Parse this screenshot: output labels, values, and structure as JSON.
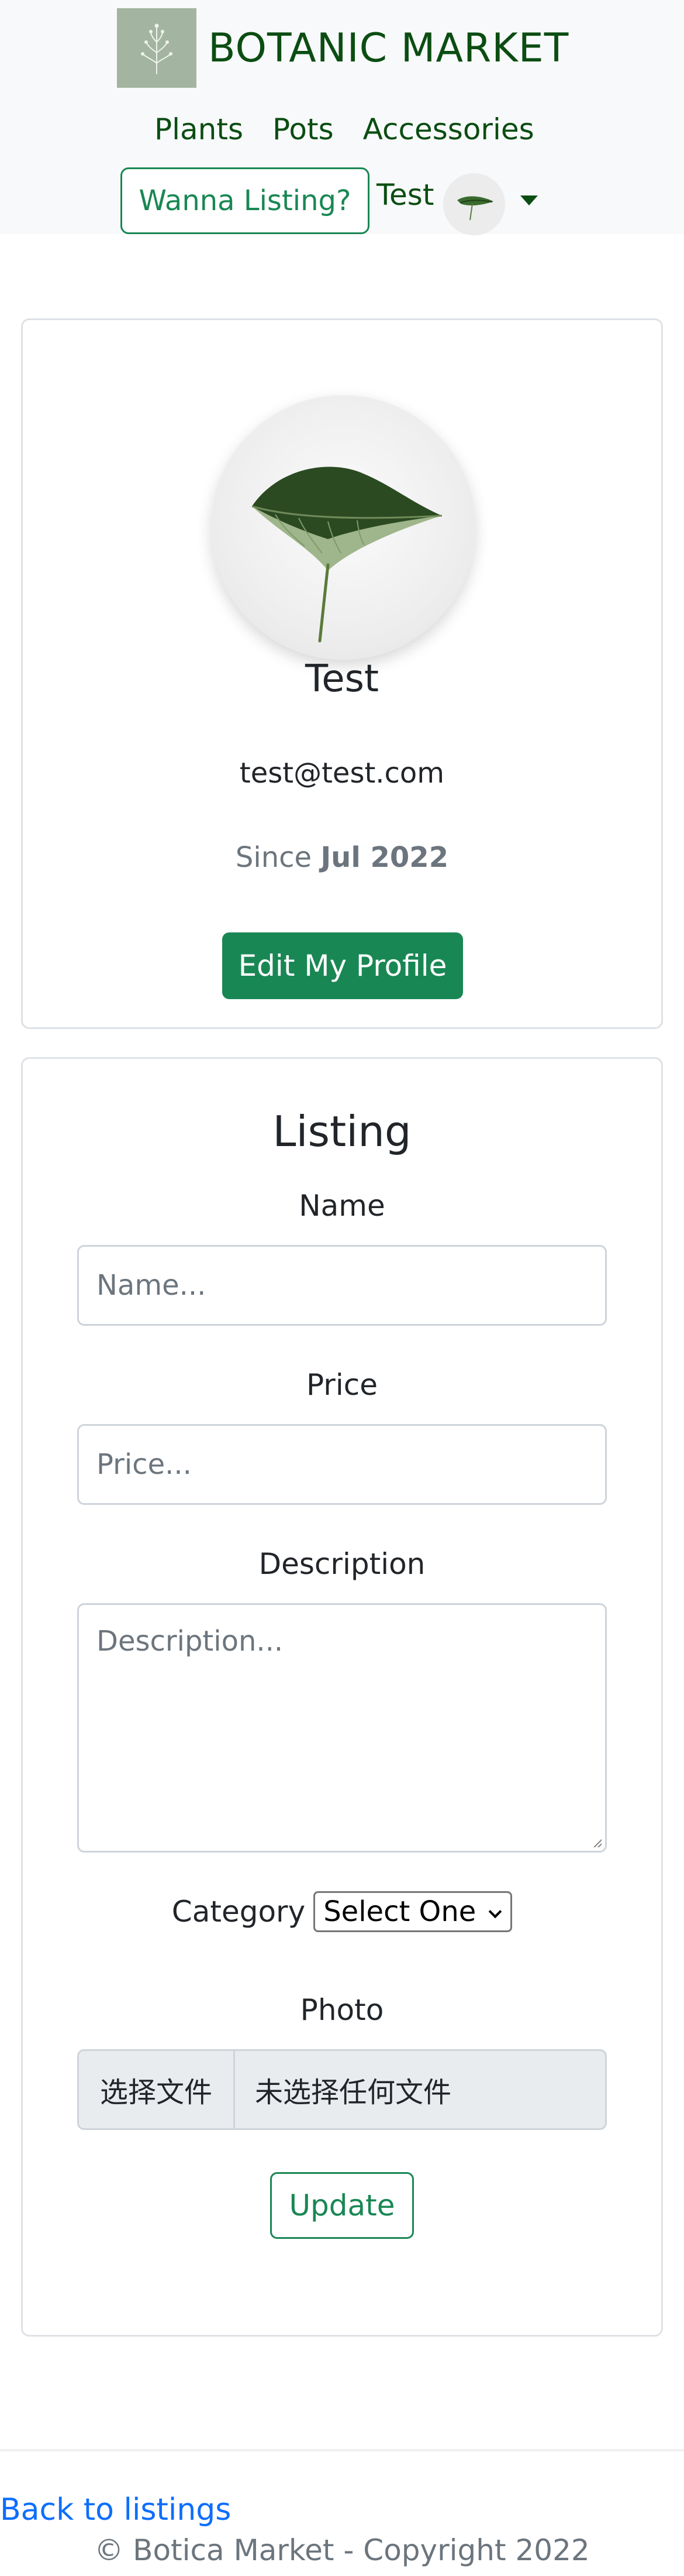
{
  "header": {
    "brand_name": "BOTANIC MARKET",
    "logo_icon": "botanical-sprig-icon",
    "nav": [
      {
        "label": "Plants"
      },
      {
        "label": "Pots"
      },
      {
        "label": "Accessories"
      }
    ],
    "listing_button": "Wanna Listing?",
    "user_name": "Test",
    "avatar_icon": "leaf-avatar-icon",
    "dropdown_icon": "caret-down-icon"
  },
  "profile": {
    "name": "Test",
    "email": "test@test.com",
    "since_prefix": "Since",
    "since_date": "Jul 2022",
    "edit_button": "Edit My Profile"
  },
  "listing": {
    "title": "Listing",
    "name_label": "Name",
    "name_placeholder": "Name...",
    "name_value": "",
    "price_label": "Price",
    "price_placeholder": "Price...",
    "price_value": "",
    "description_label": "Description",
    "description_placeholder": "Description...",
    "description_value": "",
    "category_label": "Category",
    "category_selected": "Select One",
    "photo_label": "Photo",
    "file_button": "选择文件",
    "file_status": "未选择任何文件",
    "update_button": "Update"
  },
  "footer": {
    "back_link": "Back to listings",
    "copyright": "© Botica Market - Copyright 2022"
  },
  "colors": {
    "brand_green": "#0b4d12",
    "button_green": "#198754",
    "link_blue": "#0d6efd",
    "navbar_bg": "#f8f9fa",
    "logo_bg": "#a3b5a1",
    "muted_text": "#6c757d"
  }
}
